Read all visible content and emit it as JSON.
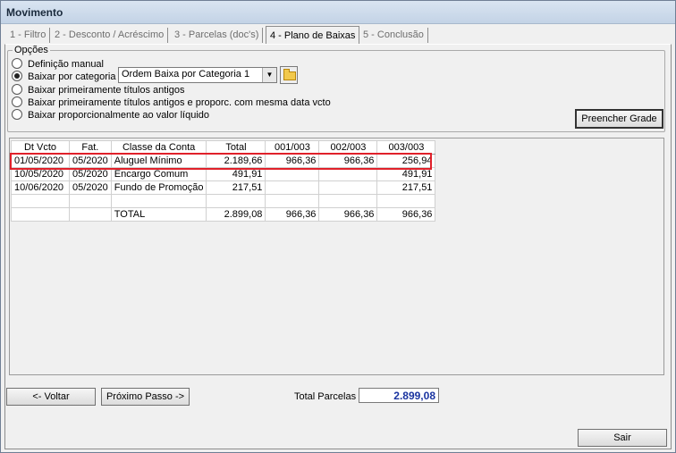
{
  "window": {
    "title": "Movimento"
  },
  "tabs": [
    {
      "label": "1 - Filtro"
    },
    {
      "label": "2 - Desconto / Acréscimo"
    },
    {
      "label": "3 - Parcelas (doc's)"
    },
    {
      "label": "4 - Plano de Baixas"
    },
    {
      "label": "5 - Conclusão"
    }
  ],
  "options": {
    "legend": "Opções",
    "radios": [
      {
        "label": "Definição manual",
        "checked": false
      },
      {
        "label": "Baixar por categoria",
        "checked": true
      },
      {
        "label": "Baixar primeiramente títulos antigos",
        "checked": false
      },
      {
        "label": "Baixar primeiramente títulos antigos e proporc. com mesma data vcto",
        "checked": false
      },
      {
        "label": "Baixar proporcionalmente ao valor líquido",
        "checked": false
      }
    ],
    "category_select": {
      "value": "Ordem Baixa por Categoria 1"
    },
    "fill_button": "Preencher Grade"
  },
  "grid": {
    "columns": [
      "Dt Vcto",
      "Fat.",
      "Classe da Conta",
      "Total",
      "001/003",
      "002/003",
      "003/003"
    ],
    "rows": [
      [
        "01/05/2020",
        "05/2020",
        "Aluguel Mínimo",
        "2.189,66",
        "966,36",
        "966,36",
        "256,94"
      ],
      [
        "10/05/2020",
        "05/2020",
        "Encargo Comum",
        "491,91",
        "",
        "",
        "491,91"
      ],
      [
        "10/06/2020",
        "05/2020",
        "Fundo de Promoção",
        "217,51",
        "",
        "",
        "217,51"
      ],
      [
        "",
        "",
        "",
        "",
        "",
        "",
        ""
      ],
      [
        "",
        "",
        "TOTAL",
        "2.899,08",
        "966,36",
        "966,36",
        "966,36"
      ]
    ]
  },
  "footer": {
    "back_button": "<- Voltar",
    "next_button": "Próximo Passo ->",
    "total_label": "Total Parcelas",
    "total_value": "2.899,08",
    "exit_button": "Sair"
  },
  "colors": {
    "highlight": "#e0202a",
    "total_value": "#1a34a0"
  }
}
